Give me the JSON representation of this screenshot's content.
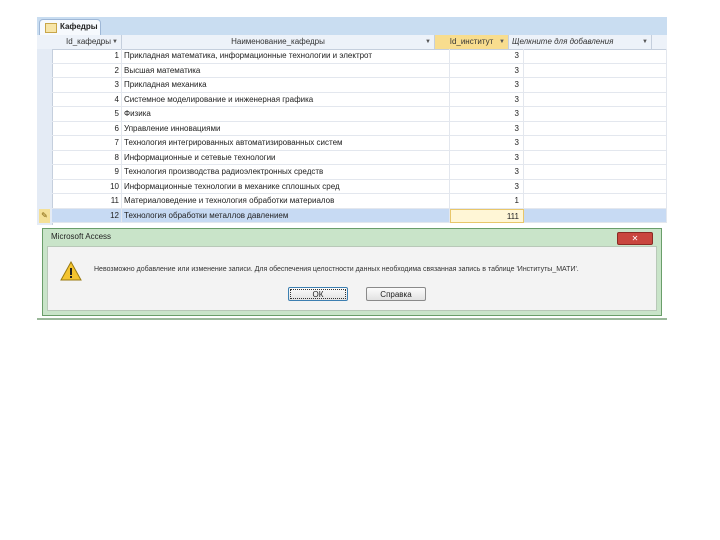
{
  "tab": {
    "label": "Кафедры"
  },
  "columns": [
    {
      "label": "Id_кафедры"
    },
    {
      "label": "Наименование_кафедры"
    },
    {
      "label": "Id_институт"
    },
    {
      "label": "Щелкните для добавления"
    }
  ],
  "rows": [
    {
      "id": "1",
      "name": "Прикладная математика, информационные технологии и электрот",
      "inst": "3"
    },
    {
      "id": "2",
      "name": "Высшая математика",
      "inst": "3"
    },
    {
      "id": "3",
      "name": "Прикладная механика",
      "inst": "3"
    },
    {
      "id": "4",
      "name": "Системное моделирование и инженерная графика",
      "inst": "3"
    },
    {
      "id": "5",
      "name": "Физика",
      "inst": "3"
    },
    {
      "id": "6",
      "name": "Управление инновациями",
      "inst": "3"
    },
    {
      "id": "7",
      "name": "Технология интегрированных автоматизированных систем",
      "inst": "3"
    },
    {
      "id": "8",
      "name": "Информационные и сетевые технологии",
      "inst": "3"
    },
    {
      "id": "9",
      "name": "Технология производства радиоэлектронных средств",
      "inst": "3"
    },
    {
      "id": "10",
      "name": "Информационные технологии в механике сплошных сред",
      "inst": "3"
    },
    {
      "id": "11",
      "name": "Материаловедение и технология обработки материалов",
      "inst": "1"
    },
    {
      "id": "12",
      "name": "Технология обработки металлов давлением",
      "inst": "111"
    }
  ],
  "new_row_marker": "✎",
  "dialog": {
    "title": "Microsoft Access",
    "close": "✕",
    "message": "Невозможно добавление или изменение записи. Для обеспечения целостности данных необходима связанная запись в таблице 'Институты_МАТИ'.",
    "ok": "ОК",
    "help": "Справка"
  }
}
